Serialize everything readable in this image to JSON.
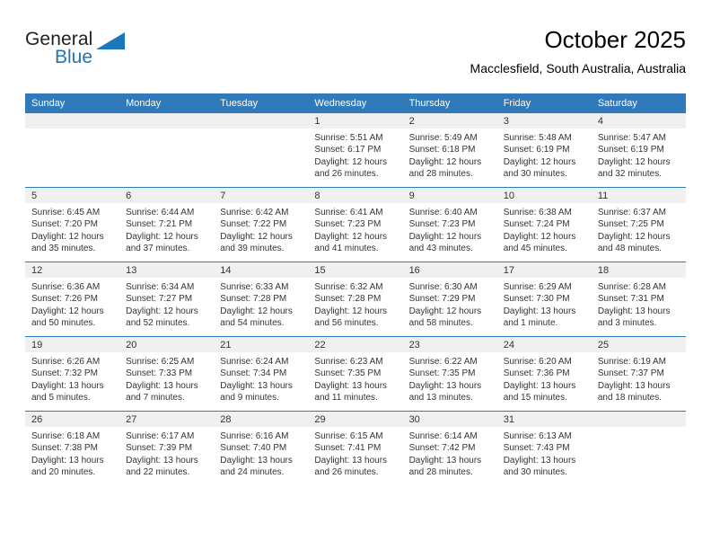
{
  "brand": {
    "name_part1": "General",
    "name_part2": "Blue",
    "accent_color": "#1c76bc"
  },
  "header": {
    "title": "October 2025",
    "subtitle": "Macclesfield, South Australia, Australia"
  },
  "theme": {
    "header_row_bg": "#3079ba",
    "daynum_band_bg": "#f0f0f0",
    "text_color": "#333333"
  },
  "weekday_headers": [
    "Sunday",
    "Monday",
    "Tuesday",
    "Wednesday",
    "Thursday",
    "Friday",
    "Saturday"
  ],
  "labels": {
    "sunrise_prefix": "Sunrise: ",
    "sunset_prefix": "Sunset: ",
    "daylight_prefix": "Daylight: "
  },
  "weeks": [
    [
      {
        "day": "",
        "empty": true
      },
      {
        "day": "",
        "empty": true
      },
      {
        "day": "",
        "empty": true
      },
      {
        "day": "1",
        "sunrise": "Sunrise: 5:51 AM",
        "sunset": "Sunset: 6:17 PM",
        "daylight_line1": "Daylight: 12 hours",
        "daylight_line2": "and 26 minutes."
      },
      {
        "day": "2",
        "sunrise": "Sunrise: 5:49 AM",
        "sunset": "Sunset: 6:18 PM",
        "daylight_line1": "Daylight: 12 hours",
        "daylight_line2": "and 28 minutes."
      },
      {
        "day": "3",
        "sunrise": "Sunrise: 5:48 AM",
        "sunset": "Sunset: 6:19 PM",
        "daylight_line1": "Daylight: 12 hours",
        "daylight_line2": "and 30 minutes."
      },
      {
        "day": "4",
        "sunrise": "Sunrise: 5:47 AM",
        "sunset": "Sunset: 6:19 PM",
        "daylight_line1": "Daylight: 12 hours",
        "daylight_line2": "and 32 minutes."
      }
    ],
    [
      {
        "day": "5",
        "sunrise": "Sunrise: 6:45 AM",
        "sunset": "Sunset: 7:20 PM",
        "daylight_line1": "Daylight: 12 hours",
        "daylight_line2": "and 35 minutes."
      },
      {
        "day": "6",
        "sunrise": "Sunrise: 6:44 AM",
        "sunset": "Sunset: 7:21 PM",
        "daylight_line1": "Daylight: 12 hours",
        "daylight_line2": "and 37 minutes."
      },
      {
        "day": "7",
        "sunrise": "Sunrise: 6:42 AM",
        "sunset": "Sunset: 7:22 PM",
        "daylight_line1": "Daylight: 12 hours",
        "daylight_line2": "and 39 minutes."
      },
      {
        "day": "8",
        "sunrise": "Sunrise: 6:41 AM",
        "sunset": "Sunset: 7:23 PM",
        "daylight_line1": "Daylight: 12 hours",
        "daylight_line2": "and 41 minutes."
      },
      {
        "day": "9",
        "sunrise": "Sunrise: 6:40 AM",
        "sunset": "Sunset: 7:23 PM",
        "daylight_line1": "Daylight: 12 hours",
        "daylight_line2": "and 43 minutes."
      },
      {
        "day": "10",
        "sunrise": "Sunrise: 6:38 AM",
        "sunset": "Sunset: 7:24 PM",
        "daylight_line1": "Daylight: 12 hours",
        "daylight_line2": "and 45 minutes."
      },
      {
        "day": "11",
        "sunrise": "Sunrise: 6:37 AM",
        "sunset": "Sunset: 7:25 PM",
        "daylight_line1": "Daylight: 12 hours",
        "daylight_line2": "and 48 minutes."
      }
    ],
    [
      {
        "day": "12",
        "sunrise": "Sunrise: 6:36 AM",
        "sunset": "Sunset: 7:26 PM",
        "daylight_line1": "Daylight: 12 hours",
        "daylight_line2": "and 50 minutes."
      },
      {
        "day": "13",
        "sunrise": "Sunrise: 6:34 AM",
        "sunset": "Sunset: 7:27 PM",
        "daylight_line1": "Daylight: 12 hours",
        "daylight_line2": "and 52 minutes."
      },
      {
        "day": "14",
        "sunrise": "Sunrise: 6:33 AM",
        "sunset": "Sunset: 7:28 PM",
        "daylight_line1": "Daylight: 12 hours",
        "daylight_line2": "and 54 minutes."
      },
      {
        "day": "15",
        "sunrise": "Sunrise: 6:32 AM",
        "sunset": "Sunset: 7:28 PM",
        "daylight_line1": "Daylight: 12 hours",
        "daylight_line2": "and 56 minutes."
      },
      {
        "day": "16",
        "sunrise": "Sunrise: 6:30 AM",
        "sunset": "Sunset: 7:29 PM",
        "daylight_line1": "Daylight: 12 hours",
        "daylight_line2": "and 58 minutes."
      },
      {
        "day": "17",
        "sunrise": "Sunrise: 6:29 AM",
        "sunset": "Sunset: 7:30 PM",
        "daylight_line1": "Daylight: 13 hours",
        "daylight_line2": "and 1 minute."
      },
      {
        "day": "18",
        "sunrise": "Sunrise: 6:28 AM",
        "sunset": "Sunset: 7:31 PM",
        "daylight_line1": "Daylight: 13 hours",
        "daylight_line2": "and 3 minutes."
      }
    ],
    [
      {
        "day": "19",
        "sunrise": "Sunrise: 6:26 AM",
        "sunset": "Sunset: 7:32 PM",
        "daylight_line1": "Daylight: 13 hours",
        "daylight_line2": "and 5 minutes."
      },
      {
        "day": "20",
        "sunrise": "Sunrise: 6:25 AM",
        "sunset": "Sunset: 7:33 PM",
        "daylight_line1": "Daylight: 13 hours",
        "daylight_line2": "and 7 minutes."
      },
      {
        "day": "21",
        "sunrise": "Sunrise: 6:24 AM",
        "sunset": "Sunset: 7:34 PM",
        "daylight_line1": "Daylight: 13 hours",
        "daylight_line2": "and 9 minutes."
      },
      {
        "day": "22",
        "sunrise": "Sunrise: 6:23 AM",
        "sunset": "Sunset: 7:35 PM",
        "daylight_line1": "Daylight: 13 hours",
        "daylight_line2": "and 11 minutes."
      },
      {
        "day": "23",
        "sunrise": "Sunrise: 6:22 AM",
        "sunset": "Sunset: 7:35 PM",
        "daylight_line1": "Daylight: 13 hours",
        "daylight_line2": "and 13 minutes."
      },
      {
        "day": "24",
        "sunrise": "Sunrise: 6:20 AM",
        "sunset": "Sunset: 7:36 PM",
        "daylight_line1": "Daylight: 13 hours",
        "daylight_line2": "and 15 minutes."
      },
      {
        "day": "25",
        "sunrise": "Sunrise: 6:19 AM",
        "sunset": "Sunset: 7:37 PM",
        "daylight_line1": "Daylight: 13 hours",
        "daylight_line2": "and 18 minutes."
      }
    ],
    [
      {
        "day": "26",
        "sunrise": "Sunrise: 6:18 AM",
        "sunset": "Sunset: 7:38 PM",
        "daylight_line1": "Daylight: 13 hours",
        "daylight_line2": "and 20 minutes."
      },
      {
        "day": "27",
        "sunrise": "Sunrise: 6:17 AM",
        "sunset": "Sunset: 7:39 PM",
        "daylight_line1": "Daylight: 13 hours",
        "daylight_line2": "and 22 minutes."
      },
      {
        "day": "28",
        "sunrise": "Sunrise: 6:16 AM",
        "sunset": "Sunset: 7:40 PM",
        "daylight_line1": "Daylight: 13 hours",
        "daylight_line2": "and 24 minutes."
      },
      {
        "day": "29",
        "sunrise": "Sunrise: 6:15 AM",
        "sunset": "Sunset: 7:41 PM",
        "daylight_line1": "Daylight: 13 hours",
        "daylight_line2": "and 26 minutes."
      },
      {
        "day": "30",
        "sunrise": "Sunrise: 6:14 AM",
        "sunset": "Sunset: 7:42 PM",
        "daylight_line1": "Daylight: 13 hours",
        "daylight_line2": "and 28 minutes."
      },
      {
        "day": "31",
        "sunrise": "Sunrise: 6:13 AM",
        "sunset": "Sunset: 7:43 PM",
        "daylight_line1": "Daylight: 13 hours",
        "daylight_line2": "and 30 minutes."
      },
      {
        "day": "",
        "empty": true
      }
    ]
  ]
}
